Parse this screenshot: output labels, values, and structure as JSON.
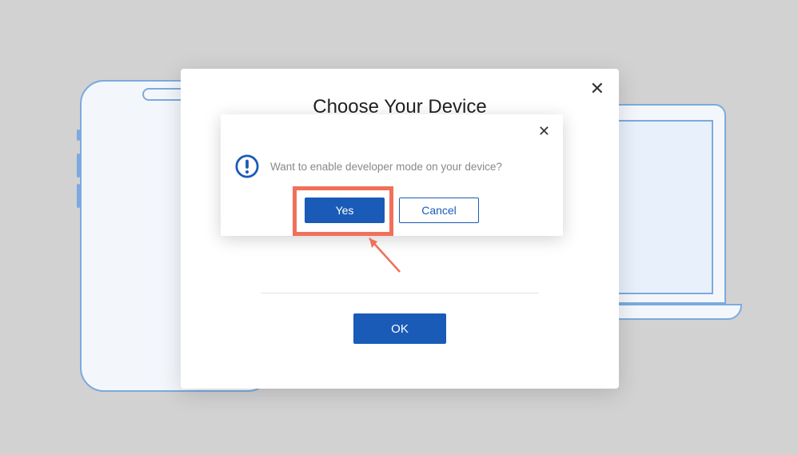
{
  "main_modal": {
    "title": "Choose Your Device",
    "ok_label": "OK"
  },
  "confirm_dialog": {
    "message": "Want to enable developer mode on your device?",
    "yes_label": "Yes",
    "cancel_label": "Cancel"
  },
  "icons": {
    "exclaim_color": "#1a5bb8",
    "highlight_color": "#f1705a"
  }
}
